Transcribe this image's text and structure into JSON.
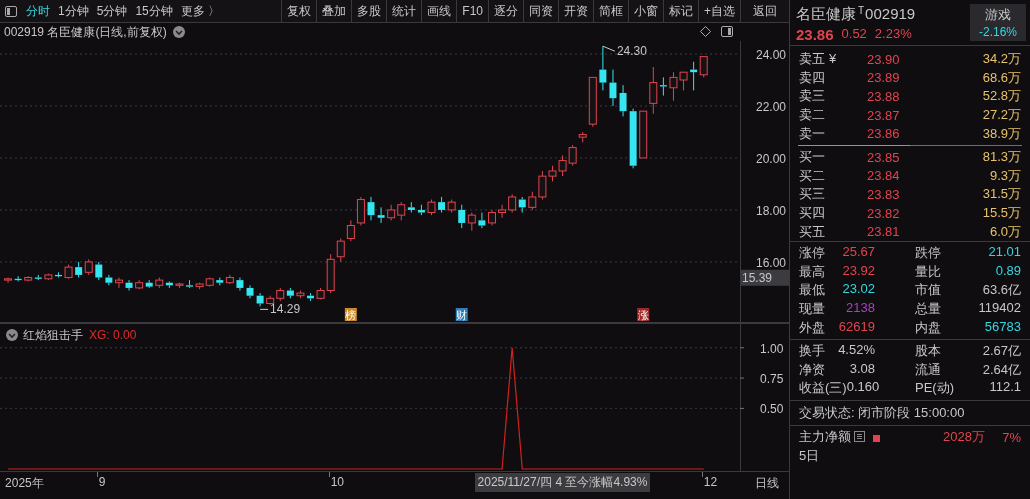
{
  "toolbar": {
    "tabs": [
      {
        "label": "分时",
        "selected": true
      },
      {
        "label": "1分钟",
        "selected": false
      },
      {
        "label": "5分钟",
        "selected": false
      },
      {
        "label": "15分钟",
        "selected": false
      },
      {
        "label": "更多 〉",
        "selected": false
      }
    ],
    "buttons": [
      "复权",
      "叠加",
      "多股",
      "统计",
      "画线",
      "F10",
      "逐分",
      "同资",
      "开资",
      "简框",
      "小窗",
      "标记",
      "+自选",
      "返回"
    ]
  },
  "chart": {
    "title": "002919 名臣健康(日线,前复权)",
    "chart_data": {
      "type": "candlestick",
      "categories": [
        null,
        null,
        null,
        null,
        null,
        null,
        null,
        null,
        null,
        null,
        null,
        null,
        null,
        null,
        null,
        null,
        null,
        null,
        null,
        null,
        null,
        null,
        null,
        null,
        null,
        null,
        null,
        null,
        null,
        null,
        null,
        null,
        null,
        null,
        null,
        null,
        null,
        null,
        null,
        null,
        null,
        null,
        null,
        null,
        null,
        null,
        null,
        null,
        null,
        null,
        null,
        null,
        null,
        null,
        null,
        null,
        null,
        null,
        null,
        null,
        null,
        null,
        null,
        null,
        null,
        null,
        null,
        null,
        null,
        null
      ],
      "ylim": [
        13.65,
        24.5
      ],
      "grid": true,
      "yticks": [
        {
          "value": 16,
          "label": "16.00"
        },
        {
          "value": 18,
          "label": "18.00"
        },
        {
          "value": 20,
          "label": "20.00"
        },
        {
          "value": 22,
          "label": "22.00"
        },
        {
          "value": 24,
          "label": "24.00"
        }
      ],
      "ohlc": [
        [
          15.3,
          15.4,
          15.2,
          15.35
        ],
        [
          15.35,
          15.45,
          15.25,
          15.3
        ],
        [
          15.3,
          15.45,
          15.25,
          15.4
        ],
        [
          15.4,
          15.5,
          15.3,
          15.35
        ],
        [
          15.35,
          15.55,
          15.3,
          15.5
        ],
        [
          15.5,
          15.6,
          15.4,
          15.45
        ],
        [
          15.4,
          15.9,
          15.35,
          15.8
        ],
        [
          15.8,
          16.0,
          15.4,
          15.5
        ],
        [
          15.6,
          16.1,
          15.5,
          16.0
        ],
        [
          15.9,
          16.0,
          15.3,
          15.4
        ],
        [
          15.4,
          15.5,
          15.1,
          15.2
        ],
        [
          15.2,
          15.4,
          15.0,
          15.3
        ],
        [
          15.2,
          15.3,
          14.9,
          15.0
        ],
        [
          15.0,
          15.3,
          14.95,
          15.2
        ],
        [
          15.2,
          15.3,
          15.0,
          15.05
        ],
        [
          15.1,
          15.4,
          15.0,
          15.3
        ],
        [
          15.2,
          15.25,
          15.0,
          15.1
        ],
        [
          15.1,
          15.2,
          15.0,
          15.15
        ],
        [
          15.1,
          15.3,
          15.0,
          15.05
        ],
        [
          15.05,
          15.2,
          14.95,
          15.15
        ],
        [
          15.1,
          15.4,
          15.05,
          15.35
        ],
        [
          15.3,
          15.4,
          15.1,
          15.2
        ],
        [
          15.2,
          15.5,
          15.15,
          15.4
        ],
        [
          15.3,
          15.4,
          14.9,
          15.0
        ],
        [
          15.0,
          15.1,
          14.6,
          14.7
        ],
        [
          14.7,
          14.8,
          14.29,
          14.4
        ],
        [
          14.4,
          14.7,
          14.35,
          14.6
        ],
        [
          14.6,
          15.0,
          14.5,
          14.9
        ],
        [
          14.9,
          15.0,
          14.6,
          14.7
        ],
        [
          14.7,
          14.9,
          14.6,
          14.8
        ],
        [
          14.7,
          14.8,
          14.5,
          14.6
        ],
        [
          14.6,
          15.0,
          14.55,
          14.9
        ],
        [
          14.9,
          16.3,
          14.8,
          16.1
        ],
        [
          16.2,
          16.9,
          16.0,
          16.8
        ],
        [
          16.9,
          17.6,
          16.8,
          17.4
        ],
        [
          17.5,
          18.5,
          17.4,
          18.4
        ],
        [
          18.3,
          18.5,
          17.6,
          17.8
        ],
        [
          17.8,
          18.1,
          17.5,
          17.7
        ],
        [
          17.7,
          18.2,
          17.6,
          18.0
        ],
        [
          17.8,
          18.3,
          17.6,
          18.2
        ],
        [
          18.1,
          18.3,
          17.9,
          18.0
        ],
        [
          18.0,
          18.2,
          17.8,
          17.9
        ],
        [
          17.9,
          18.4,
          17.8,
          18.3
        ],
        [
          18.3,
          18.5,
          17.9,
          18.0
        ],
        [
          18.0,
          18.4,
          17.9,
          18.3
        ],
        [
          18.0,
          18.2,
          17.3,
          17.5
        ],
        [
          17.5,
          17.9,
          17.2,
          17.8
        ],
        [
          17.6,
          17.9,
          17.3,
          17.4
        ],
        [
          17.5,
          18.0,
          17.4,
          17.9
        ],
        [
          17.9,
          18.2,
          17.7,
          18.0
        ],
        [
          18.0,
          18.6,
          17.9,
          18.5
        ],
        [
          18.4,
          18.5,
          17.9,
          18.1
        ],
        [
          18.1,
          18.7,
          18.0,
          18.5
        ],
        [
          18.5,
          19.5,
          18.4,
          19.3
        ],
        [
          19.3,
          19.7,
          19.1,
          19.5
        ],
        [
          19.5,
          20.1,
          19.3,
          19.9
        ],
        [
          19.8,
          20.5,
          19.7,
          20.4
        ],
        [
          20.8,
          21.0,
          20.6,
          20.9
        ],
        [
          21.3,
          23.1,
          21.2,
          23.1
        ],
        [
          23.4,
          24.3,
          22.6,
          22.9
        ],
        [
          22.9,
          23.4,
          22.0,
          22.3
        ],
        [
          22.5,
          22.8,
          21.6,
          21.8
        ],
        [
          21.8,
          21.9,
          19.6,
          19.7
        ],
        [
          20.0,
          21.8,
          20.0,
          21.8
        ],
        [
          22.1,
          23.5,
          21.7,
          22.9
        ],
        [
          22.8,
          23.1,
          22.4,
          22.75
        ],
        [
          22.7,
          23.3,
          22.2,
          23.1
        ],
        [
          23.0,
          23.3,
          22.6,
          23.3
        ],
        [
          23.4,
          23.7,
          22.6,
          23.3
        ],
        [
          23.2,
          23.9,
          23.1,
          23.9
        ]
      ]
    },
    "high_label": "24.30",
    "low_label": "14.29",
    "cursor_price": "15.39",
    "event_tags": [
      {
        "text": "榜",
        "color": "#c98a2e"
      },
      {
        "text": "财",
        "color": "#2f7fb8"
      },
      {
        "text": "涨",
        "color": "#9c2a2a"
      }
    ]
  },
  "indicator": {
    "name": "红焰狙击手",
    "reading": "XG: 0.00",
    "chart_data": {
      "type": "line",
      "categories": [
        null,
        null,
        null,
        null,
        null,
        null,
        null,
        null,
        null,
        null,
        null,
        null,
        null,
        null,
        null,
        null,
        null,
        null,
        null,
        null,
        null,
        null,
        null,
        null,
        null,
        null,
        null,
        null,
        null,
        null,
        null,
        null,
        null,
        null,
        null,
        null,
        null,
        null,
        null,
        null,
        null,
        null,
        null,
        null,
        null,
        null,
        null,
        null,
        null,
        null,
        null,
        null,
        null,
        null,
        null,
        null,
        null,
        null,
        null,
        null,
        null,
        null,
        null,
        null,
        null,
        null,
        null,
        null,
        null,
        null
      ],
      "ylim": [
        0,
        1.2
      ],
      "grid": true,
      "yticks": [
        {
          "value": 1,
          "label": "1.00"
        },
        {
          "value": 0.75,
          "label": "0.75"
        },
        {
          "value": 0.5,
          "label": "0.50"
        }
      ],
      "values": [
        0,
        0,
        0,
        0,
        0,
        0,
        0,
        0,
        0,
        0,
        0,
        0,
        0,
        0,
        0,
        0,
        0,
        0,
        0,
        0,
        0,
        0,
        0,
        0,
        0,
        0,
        0,
        0,
        0,
        0,
        0,
        0,
        0,
        0,
        0,
        0,
        0,
        0,
        0,
        0,
        0,
        0,
        0,
        0,
        0,
        0,
        0,
        0,
        0,
        0,
        1,
        0,
        0,
        0,
        0,
        0,
        0,
        0,
        0,
        0,
        0,
        0,
        0,
        0,
        0,
        0,
        0,
        0,
        0,
        0
      ]
    }
  },
  "x_axis": {
    "ticks": [
      "2025年",
      "9",
      "10",
      "12"
    ],
    "cursor": "2025/11/27/四 4 至今涨幅4.93%",
    "period": "日线"
  },
  "quote": {
    "name": "名臣健康",
    "mark": "T",
    "code": "002919",
    "price": "23.86",
    "change": "0.52",
    "change_pct": "2.23%",
    "game_button": "游戏",
    "game_value": "-2.16%"
  },
  "asks": [
    {
      "label": "卖五",
      "currency": "¥",
      "price": "23.90",
      "volume": "34.2万"
    },
    {
      "label": "卖四",
      "price": "23.89",
      "volume": "68.6万"
    },
    {
      "label": "卖三",
      "price": "23.88",
      "volume": "52.8万"
    },
    {
      "label": "卖二",
      "price": "23.87",
      "volume": "27.2万"
    },
    {
      "label": "卖一",
      "price": "23.86",
      "volume": "38.9万"
    }
  ],
  "bids": [
    {
      "label": "买一",
      "price": "23.85",
      "volume": "81.3万"
    },
    {
      "label": "买二",
      "price": "23.84",
      "volume": "9.3万"
    },
    {
      "label": "买三",
      "price": "23.83",
      "volume": "31.5万"
    },
    {
      "label": "买四",
      "price": "23.82",
      "volume": "15.5万"
    },
    {
      "label": "买五",
      "price": "23.81",
      "volume": "6.0万"
    }
  ],
  "stats": [
    [
      {
        "label": "涨停",
        "value": "25.67",
        "color": "#e0454f"
      },
      {
        "label": "跌停",
        "value": "21.01",
        "color": "#35d6e0"
      }
    ],
    [
      {
        "label": "最高",
        "value": "23.92",
        "color": "#e0454f"
      },
      {
        "label": "量比",
        "value": "0.89",
        "color": "#35d6e0"
      }
    ],
    [
      {
        "label": "最低",
        "value": "23.02",
        "color": "#35d6e0"
      },
      {
        "label": "市值",
        "value": "63.6亿",
        "color": "#c8c8c8"
      }
    ],
    [
      {
        "label": "现量",
        "value": "2138",
        "color": "#b03ccc"
      },
      {
        "label": "总量",
        "value": "119402",
        "color": "#c8c8c8"
      }
    ],
    [
      {
        "label": "外盘",
        "value": "62619",
        "color": "#e0454f"
      },
      {
        "label": "内盘",
        "value": "56783",
        "color": "#35d6e0"
      }
    ]
  ],
  "fundamentals": [
    [
      {
        "label": "换手",
        "value": "4.52%"
      },
      {
        "label": "股本",
        "value": "2.67亿"
      }
    ],
    [
      {
        "label": "净资",
        "value": "3.08"
      },
      {
        "label": "流通",
        "value": "2.64亿"
      }
    ],
    [
      {
        "label": "收益(三)",
        "value": "0.160"
      },
      {
        "label": "PE(动)",
        "value": "112.1"
      }
    ]
  ],
  "trade_status": "交易状态: 闭市阶段 15:00:00",
  "main_flow": {
    "label": "主力净额",
    "value": "2028万",
    "pct": "7%",
    "period": "5日"
  }
}
